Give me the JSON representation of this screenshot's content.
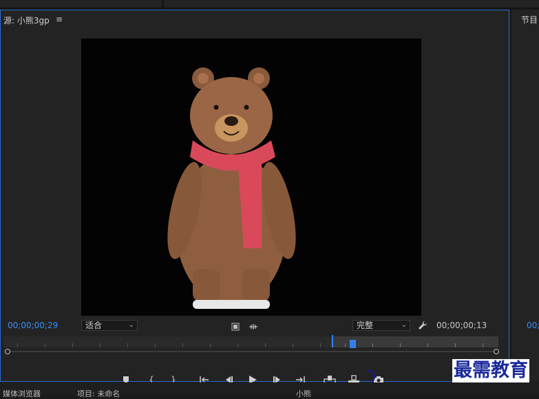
{
  "source_panel": {
    "title": "源: 小熊3gp",
    "menu_icon": "hamburger-menu-icon"
  },
  "program_panel": {
    "title": "节目",
    "timecode": "00;"
  },
  "monitor": {
    "timecode_current": "00;00;00;29",
    "timecode_duration": "00;00;00;13",
    "fit_value": "适合",
    "quality_value": "完整",
    "timecode_current_color": "#3d8df5"
  },
  "controls": {
    "buttons": [
      "add-marker",
      "mark-in",
      "mark-out",
      "go-to-in",
      "step-back",
      "play",
      "step-forward",
      "go-to-out",
      "insert",
      "overwrite",
      "export-frame"
    ]
  },
  "bottom_tabs": [
    "媒体浏览器",
    "项目: 未命名",
    "小熊"
  ],
  "watermark": "最需教育",
  "colors": {
    "panel_border": "#2b6fd1",
    "accent": "#2f80ed",
    "annotation": "#1a1a9e"
  }
}
